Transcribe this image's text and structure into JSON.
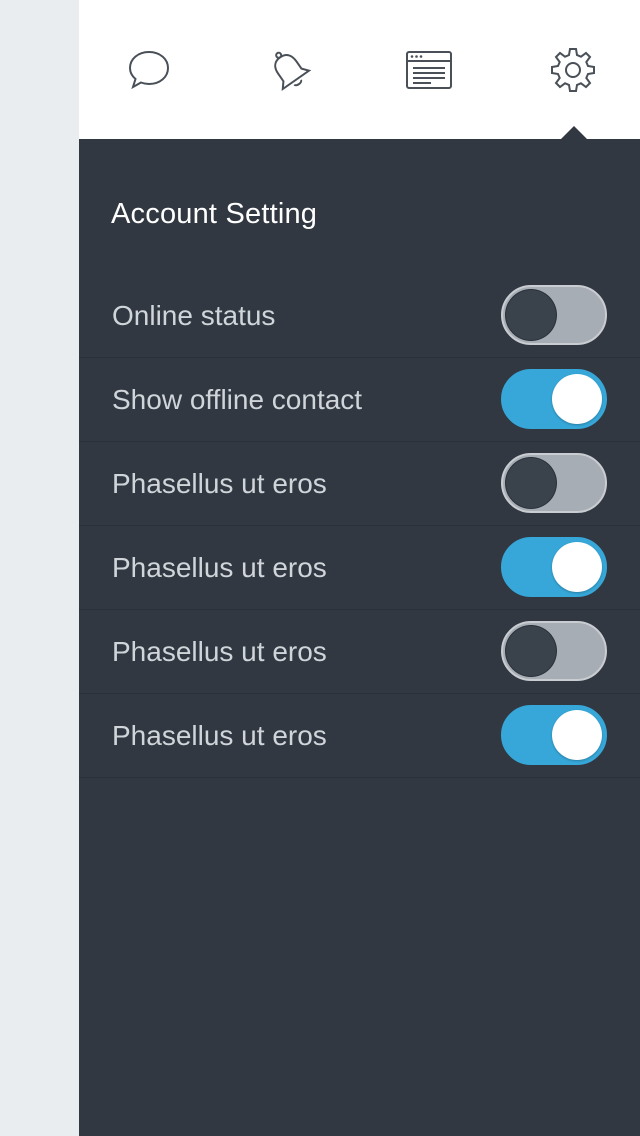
{
  "tabs": [
    {
      "name": "chat",
      "icon": "chat-bubble-icon"
    },
    {
      "name": "notifications",
      "icon": "bell-icon"
    },
    {
      "name": "browser",
      "icon": "browser-window-icon"
    },
    {
      "name": "settings",
      "icon": "gear-icon",
      "active": true
    }
  ],
  "section": {
    "title": "Account Setting"
  },
  "settings": [
    {
      "label": "Online status",
      "enabled": false
    },
    {
      "label": "Show offline contact",
      "enabled": true
    },
    {
      "label": "Phasellus ut eros",
      "enabled": false
    },
    {
      "label": "Phasellus ut eros",
      "enabled": true
    },
    {
      "label": "Phasellus ut eros",
      "enabled": false
    },
    {
      "label": "Phasellus ut eros",
      "enabled": true
    }
  ],
  "colors": {
    "panel_bg": "#313841",
    "accent_on": "#36a7d8",
    "toggle_off": "#a7adb4",
    "topbar_bg": "#ffffff",
    "sidebar_strip": "#e9edf0",
    "icon_stroke": "#4a5058"
  }
}
